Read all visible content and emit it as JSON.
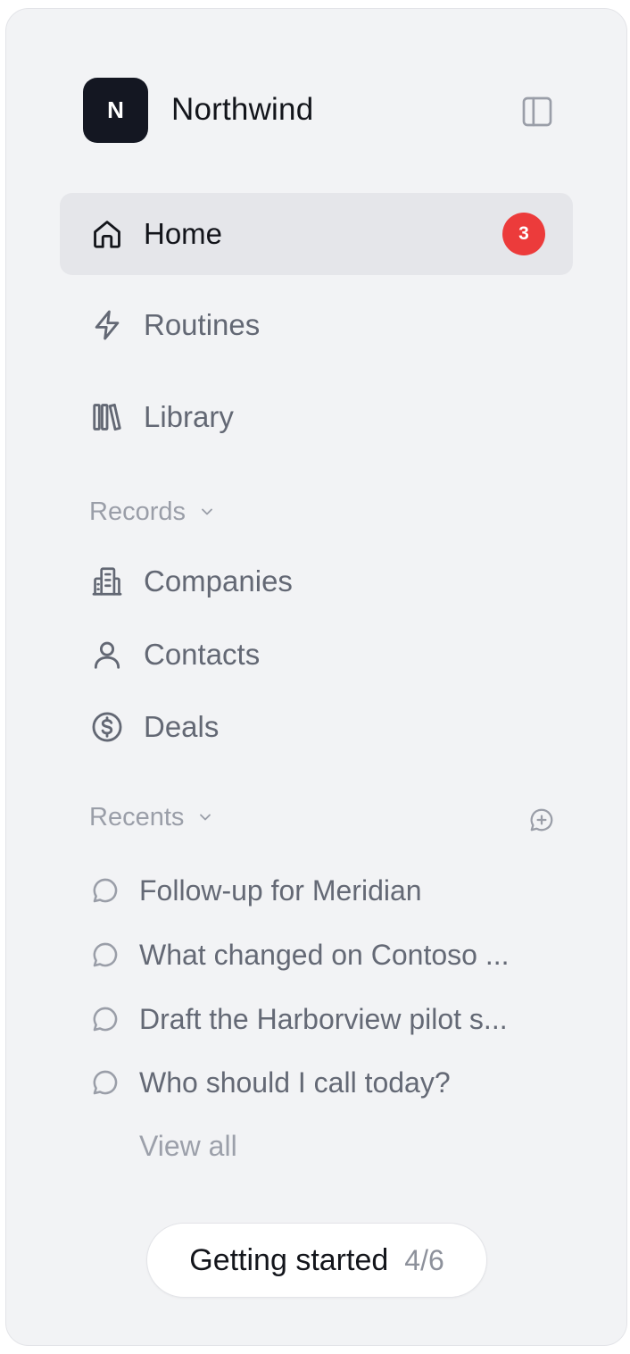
{
  "brand": {
    "logo_letter": "N",
    "name": "Northwind"
  },
  "nav": {
    "items": [
      {
        "label": "Home",
        "icon": "home-icon",
        "active": true,
        "badge": "3"
      },
      {
        "label": "Routines",
        "icon": "lightning-icon",
        "active": false
      },
      {
        "label": "Library",
        "icon": "library-icon",
        "active": false
      }
    ]
  },
  "records": {
    "label": "Records",
    "items": [
      {
        "label": "Companies",
        "icon": "building-icon"
      },
      {
        "label": "Contacts",
        "icon": "user-icon"
      },
      {
        "label": "Deals",
        "icon": "dollar-circle-icon"
      }
    ]
  },
  "recents": {
    "label": "Recents",
    "items": [
      {
        "label": "Follow-up for Meridian"
      },
      {
        "label": "What changed on Contoso ..."
      },
      {
        "label": "Draft the Harborview pilot s..."
      },
      {
        "label": "Who should I call today?"
      }
    ],
    "view_all_label": "View all"
  },
  "getting_started": {
    "label": "Getting started",
    "progress": "4/6"
  },
  "colors": {
    "badge": "#ec3b3b",
    "logo_bg": "#141722",
    "sidebar_bg": "#f2f3f5",
    "active_bg": "#e5e6ea"
  }
}
